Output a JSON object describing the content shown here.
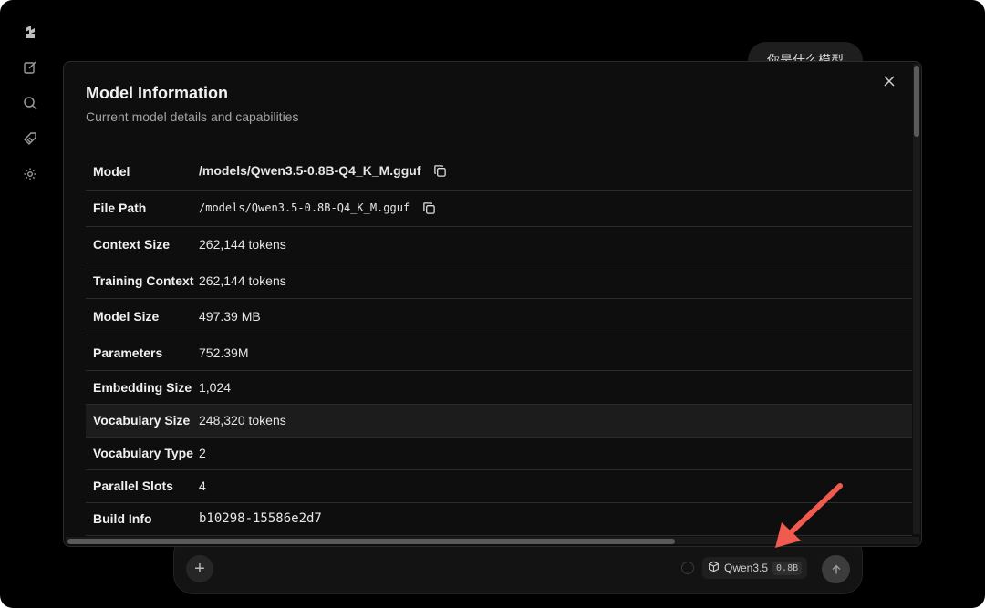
{
  "user_message": "你是什么模型",
  "rail": {
    "icons": [
      "logo-icon",
      "edit-icon",
      "search-icon",
      "tag-icon",
      "gear-icon"
    ]
  },
  "modal": {
    "title": "Model Information",
    "subtitle": "Current model details and capabilities",
    "rows": [
      {
        "label": "Model",
        "value": "/models/Qwen3.5-0.8B-Q4_K_M.gguf"
      },
      {
        "label": "File Path",
        "value": "/models/Qwen3.5-0.8B-Q4_K_M.gguf"
      },
      {
        "label": "Context Size",
        "value": "262,144 tokens"
      },
      {
        "label": "Training Context",
        "value": "262,144 tokens"
      },
      {
        "label": "Model Size",
        "value": "497.39 MB"
      },
      {
        "label": "Parameters",
        "value": "752.39M"
      },
      {
        "label": "Embedding Size",
        "value": "1,024"
      },
      {
        "label": "Vocabulary Size",
        "value": "248,320 tokens"
      },
      {
        "label": "Vocabulary Type",
        "value": "2"
      },
      {
        "label": "Parallel Slots",
        "value": "4"
      },
      {
        "label": "Build Info",
        "value": "b10298-15586e2d7"
      }
    ]
  },
  "composer": {
    "model_name": "Qwen3.5",
    "model_badge": "0.8B"
  },
  "colors": {
    "background": "#000000",
    "modal_bg": "#0e0e0e",
    "annotation_arrow": "#f05a4f"
  }
}
